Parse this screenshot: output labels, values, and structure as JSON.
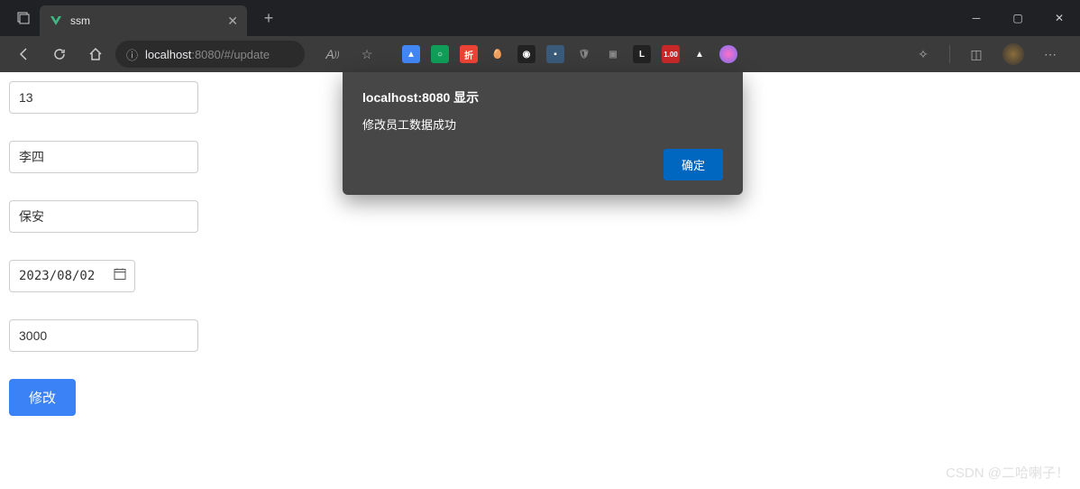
{
  "browser": {
    "tab_title": "ssm",
    "url_host": "localhost",
    "url_port": ":8080",
    "url_path": "/#/update"
  },
  "form": {
    "id_value": "13",
    "name_value": "李四",
    "role_value": "保安",
    "date_value": "2023/08/02",
    "salary_value": "3000",
    "submit_label": "修改"
  },
  "alert": {
    "title": "localhost:8080 显示",
    "message": "修改员工数据成功",
    "ok_label": "确定"
  },
  "watermark": "CSDN @二哈喇子！"
}
